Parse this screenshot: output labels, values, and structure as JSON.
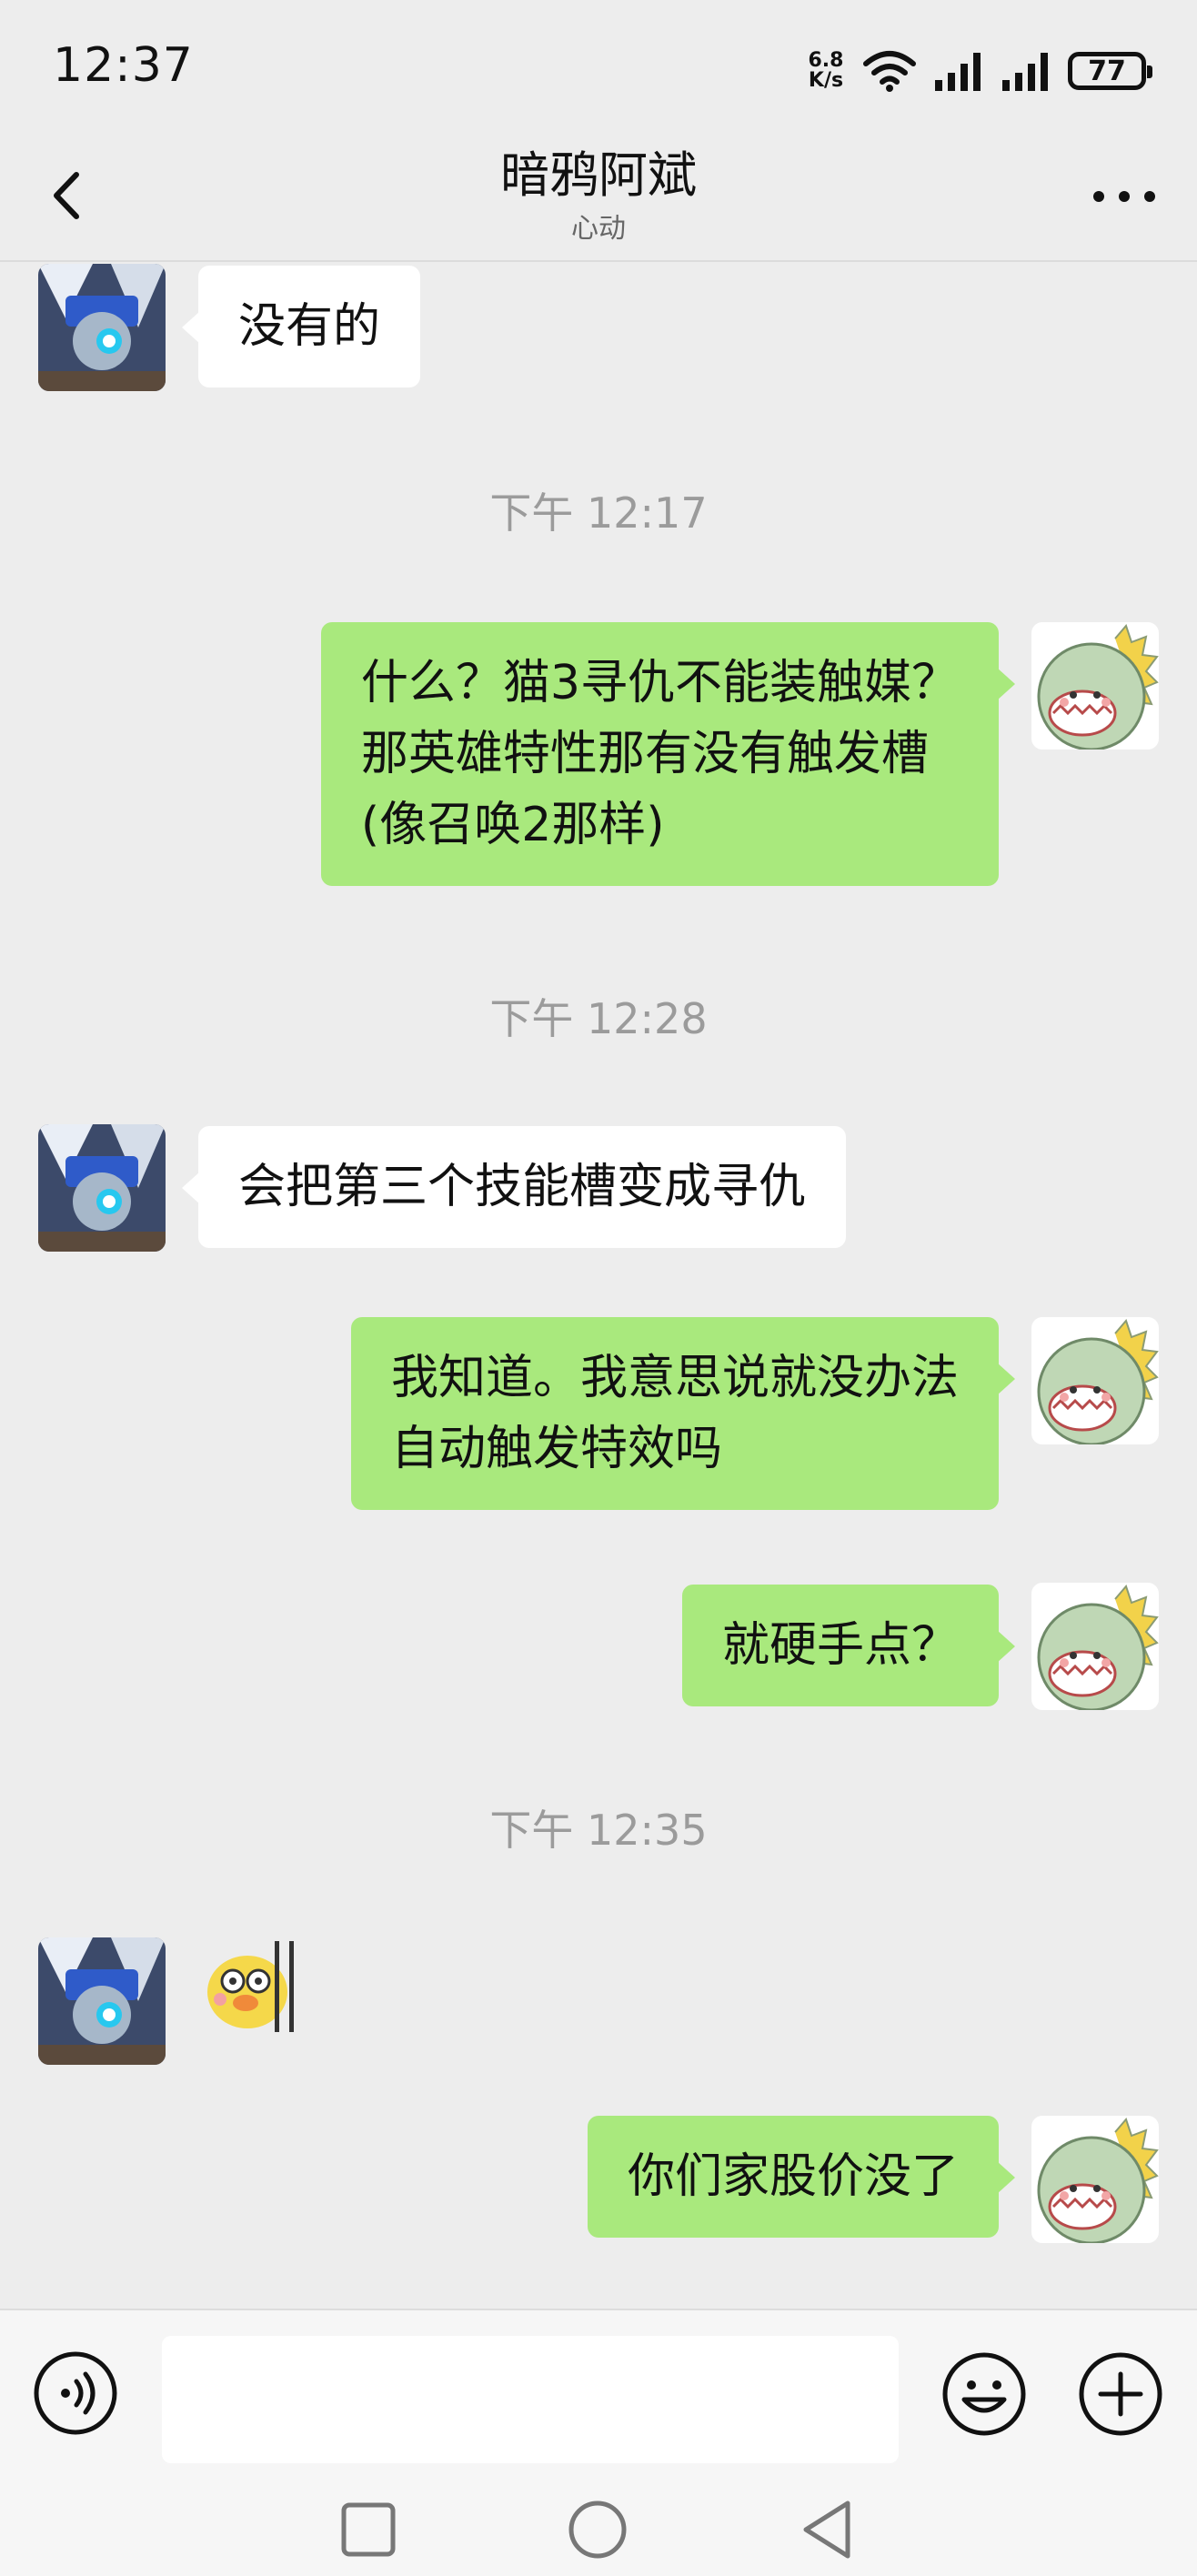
{
  "status_bar": {
    "time": "12:37",
    "net_speed_value": "6.8",
    "net_speed_unit": "K/s",
    "battery": "77"
  },
  "header": {
    "title": "暗鸦阿斌",
    "subtitle": "心动"
  },
  "messages": [
    {
      "side": "left",
      "text": "没有的"
    },
    {
      "timestamp": "下午 12:17"
    },
    {
      "side": "right",
      "text": "什么？猫3寻仇不能装触媒？\n那英雄特性那有没有触发槽\n(像召唤2那样)"
    },
    {
      "timestamp": "下午 12:28"
    },
    {
      "side": "left",
      "text": "会把第三个技能槽变成寻仇"
    },
    {
      "side": "right",
      "text": "我知道。我意思说就没办法\n自动触发特效吗"
    },
    {
      "side": "right",
      "text": "就硬手点？"
    },
    {
      "timestamp": "下午 12:35"
    },
    {
      "side": "left",
      "sticker": true
    },
    {
      "side": "right",
      "text": "你们家股价没了"
    }
  ],
  "colors": {
    "background": "#ededed",
    "bubble_self": "#a9e97d",
    "bubble_other": "#ffffff",
    "timestamp_text": "#9b9b9b"
  },
  "input_bar": {
    "value": ""
  }
}
